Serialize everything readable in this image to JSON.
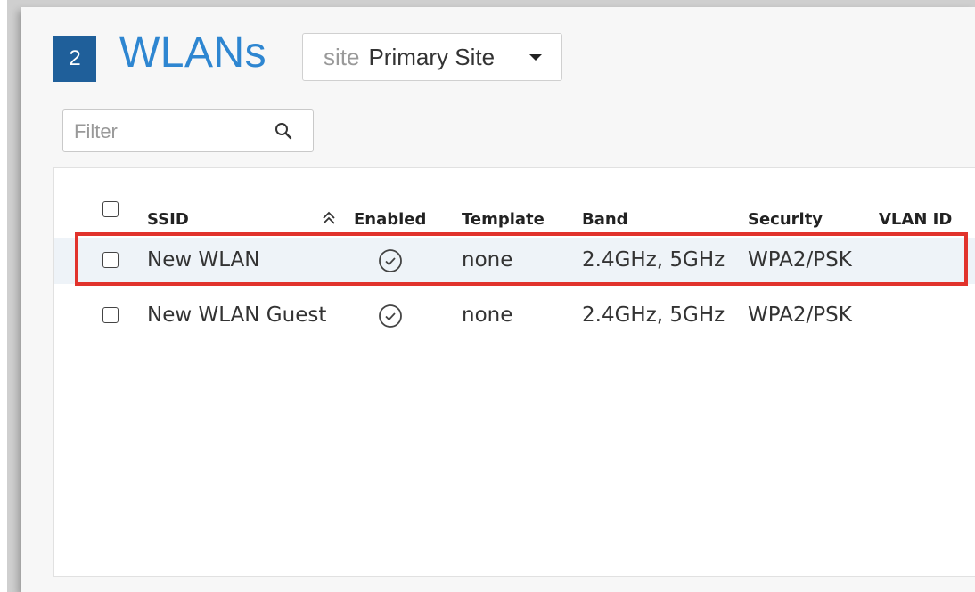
{
  "header": {
    "count": "2",
    "title": "WLANs",
    "site_label": "site",
    "site_value": "Primary Site"
  },
  "filter": {
    "placeholder": "Filter"
  },
  "table": {
    "columns": [
      "SSID",
      "Enabled",
      "Template",
      "Band",
      "Security",
      "VLAN ID"
    ],
    "rows": [
      {
        "ssid": "New WLAN",
        "enabled": true,
        "template": "none",
        "band": "2.4GHz, 5GHz",
        "security": "WPA2/PSK",
        "vlan_id": ""
      },
      {
        "ssid": "New WLAN Guest",
        "enabled": true,
        "template": "none",
        "band": "2.4GHz, 5GHz",
        "security": "WPA2/PSK",
        "vlan_id": ""
      }
    ]
  },
  "colors": {
    "accent": "#2e86d1",
    "badge": "#1f5f9a",
    "highlight_border": "#e1332c",
    "row_highlight": "#eef3f8"
  }
}
